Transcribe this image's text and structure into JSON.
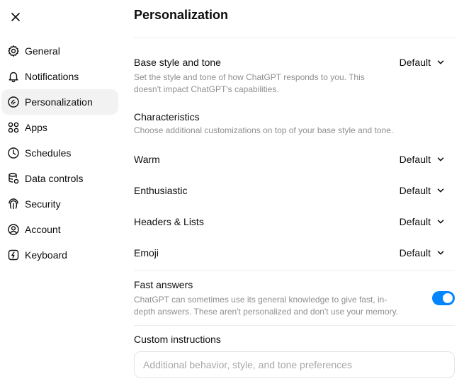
{
  "sidebar": {
    "close_icon": "close-icon",
    "items": [
      {
        "label": "General",
        "icon": "gear-icon"
      },
      {
        "label": "Notifications",
        "icon": "bell-icon"
      },
      {
        "label": "Personalization",
        "icon": "personalization-icon",
        "active": true
      },
      {
        "label": "Apps",
        "icon": "apps-grid-icon"
      },
      {
        "label": "Schedules",
        "icon": "clock-icon"
      },
      {
        "label": "Data controls",
        "icon": "database-icon"
      },
      {
        "label": "Security",
        "icon": "fingerprint-icon"
      },
      {
        "label": "Account",
        "icon": "user-circle-icon"
      },
      {
        "label": "Keyboard",
        "icon": "keyboard-icon"
      }
    ]
  },
  "main": {
    "title": "Personalization",
    "base_style": {
      "title": "Base style and tone",
      "description_line1": "Set the style and tone of how ChatGPT responds to you. This",
      "description_line2": "doesn't impact ChatGPT's capabilities.",
      "value": "Default"
    },
    "characteristics": {
      "title": "Characteristics",
      "description": "Choose additional customizations on top of your base style and tone.",
      "items": [
        {
          "label": "Warm",
          "value": "Default"
        },
        {
          "label": "Enthusiastic",
          "value": "Default"
        },
        {
          "label": "Headers & Lists",
          "value": "Default"
        },
        {
          "label": "Emoji",
          "value": "Default"
        }
      ]
    },
    "fast_answers": {
      "title": "Fast answers",
      "description_line1": "ChatGPT can sometimes use its general knowledge to give fast, in-",
      "description_line2": "depth answers. These aren't personalized and don't use your memory.",
      "enabled": true
    },
    "custom_instructions": {
      "title": "Custom instructions",
      "placeholder": "Additional behavior, style, and tone preferences",
      "value": ""
    }
  },
  "colors": {
    "accent": "#0285ff",
    "active_bg": "#f2f2f2",
    "muted_text": "#8f8f8f",
    "divider": "#ececec"
  }
}
